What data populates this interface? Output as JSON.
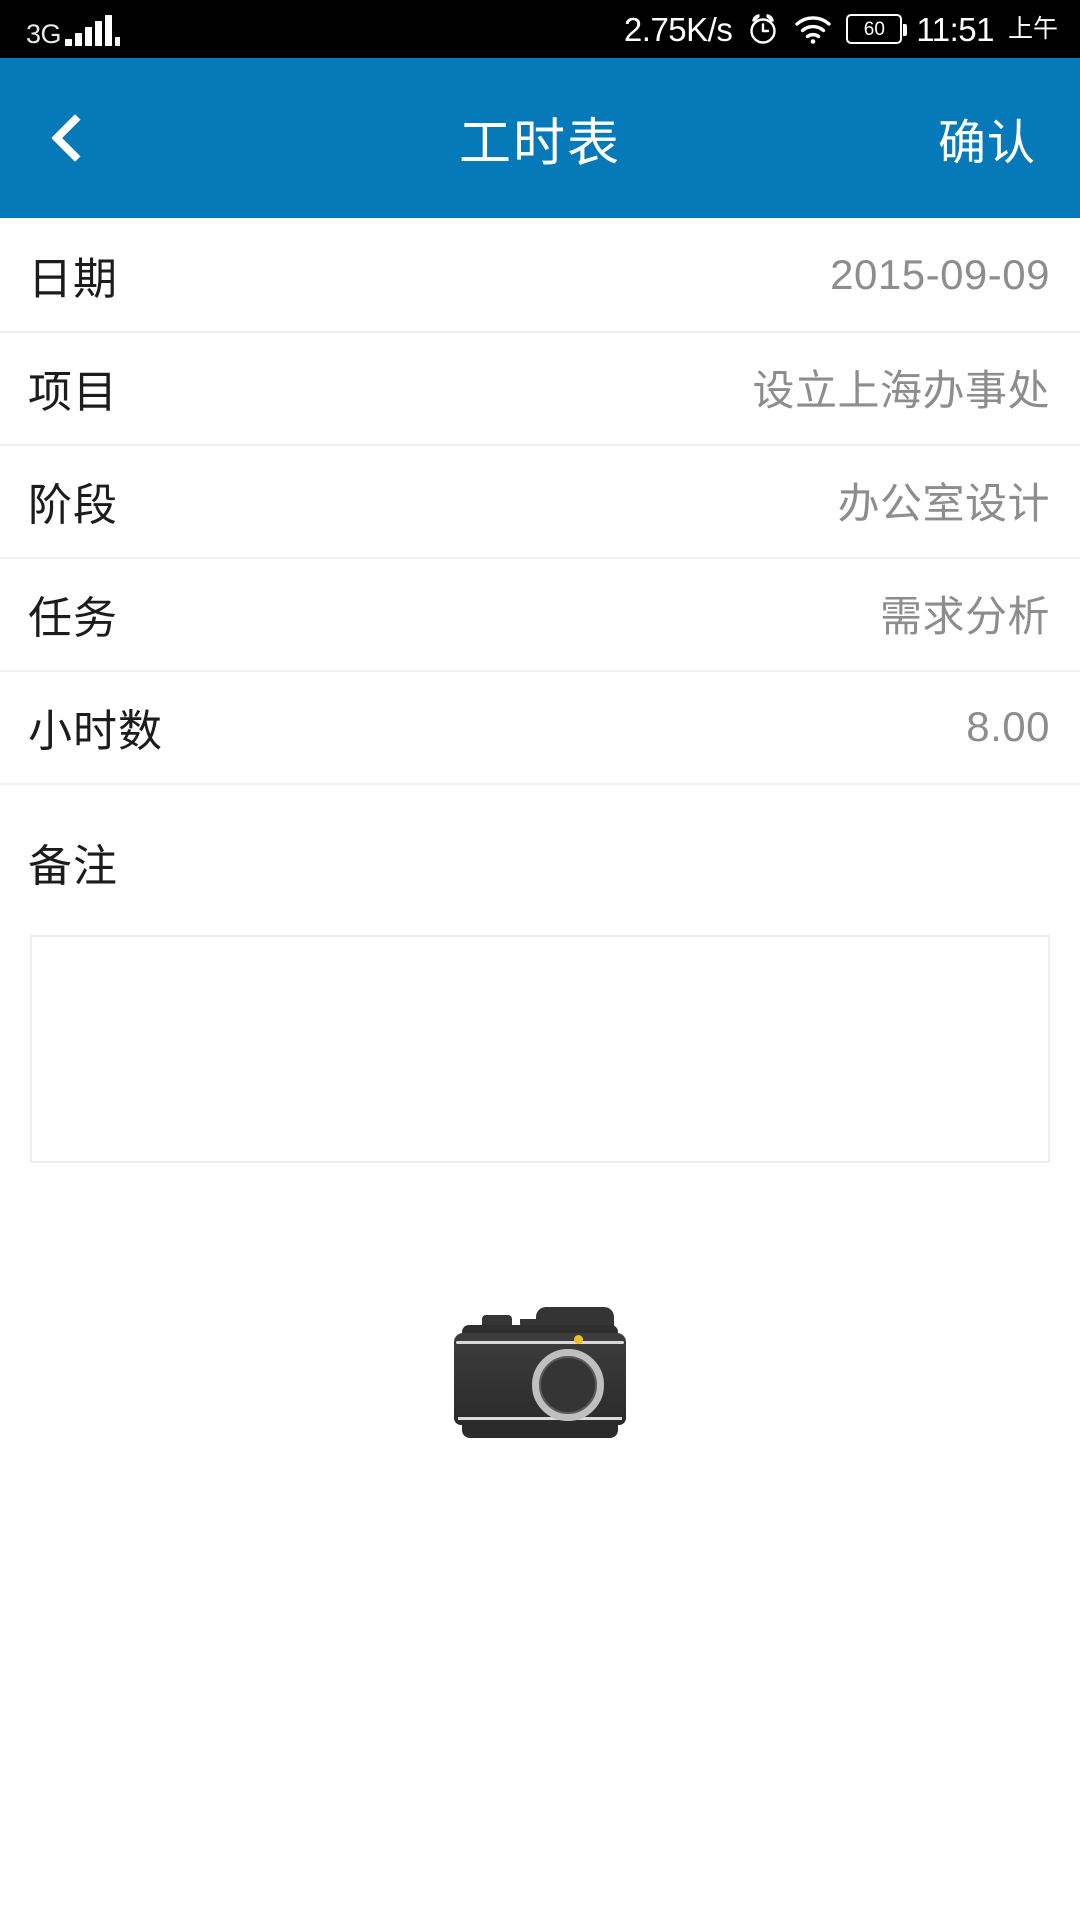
{
  "statusbar": {
    "network_type": "3G",
    "signal_icon": "signal-bars-icon",
    "net_speed": "2.75K/s",
    "alarm_icon": "alarm-clock-icon",
    "wifi_icon": "wifi-icon",
    "battery_level": "60",
    "time": "11:51",
    "am_pm": "上午"
  },
  "header": {
    "back_icon": "chevron-left-icon",
    "title": "工时表",
    "confirm_label": "确认",
    "background_color": "#0679B8"
  },
  "form": {
    "rows": [
      {
        "label": "日期",
        "value": "2015-09-09"
      },
      {
        "label": "项目",
        "value": "设立上海办事处"
      },
      {
        "label": "阶段",
        "value": "办公室设计"
      },
      {
        "label": "任务",
        "value": "需求分析"
      },
      {
        "label": "小时数",
        "value": "8.00"
      }
    ],
    "remarks": {
      "label": "备注",
      "value": "",
      "placeholder": ""
    }
  },
  "attachment": {
    "camera_icon": "camera-icon"
  },
  "colors": {
    "accent": "#0679B8",
    "label_text": "#1c1c1c",
    "value_text": "#8d8d8d",
    "divider": "#f0f0f0",
    "textarea_border": "#ededed",
    "statusbar_bg": "#000000"
  }
}
